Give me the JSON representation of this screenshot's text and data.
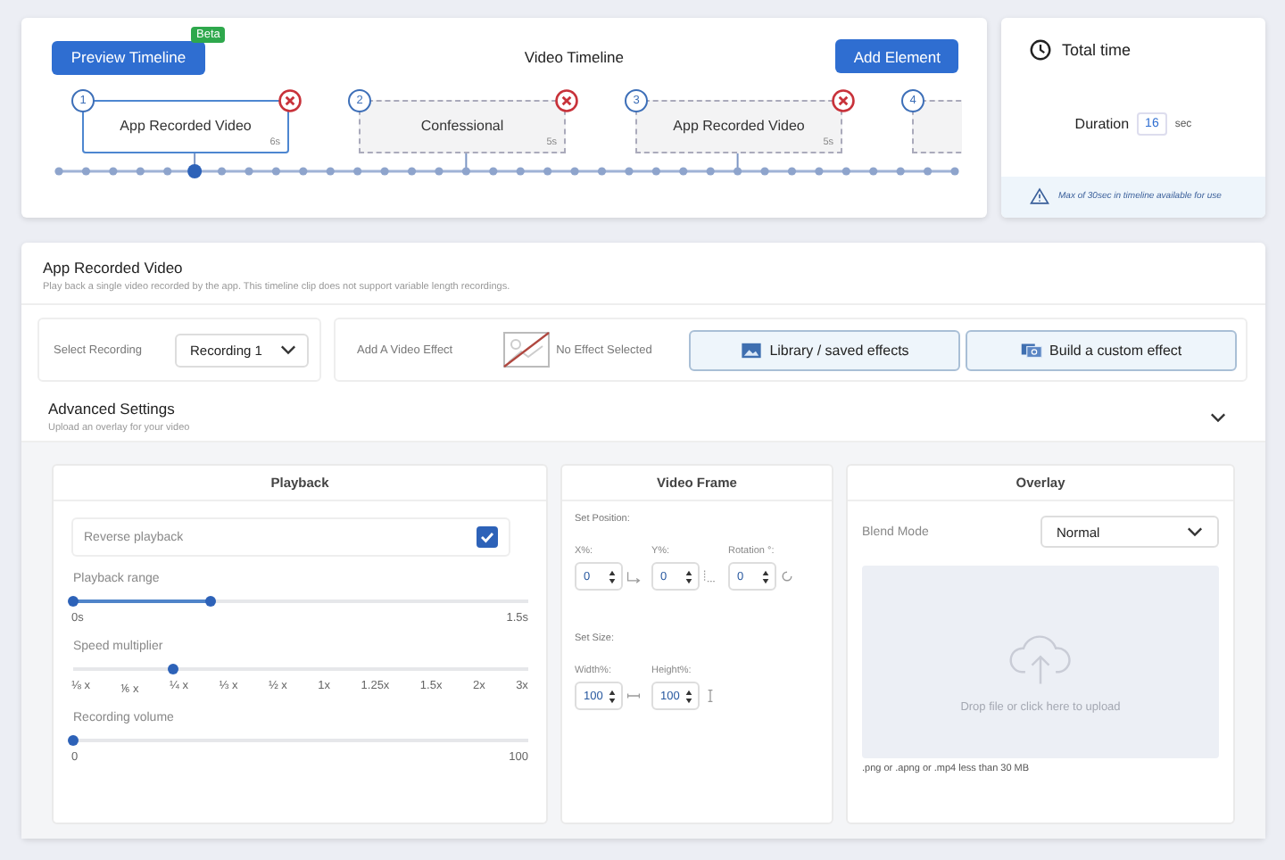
{
  "timeline": {
    "preview_button": "Preview Timeline",
    "badge": "Beta",
    "title": "Video Timeline",
    "add_button": "Add Element",
    "clips": [
      {
        "number": "1",
        "title": "App Recorded Video",
        "duration": "6s",
        "selected": true
      },
      {
        "number": "2",
        "title": "Confessional",
        "duration": "5s",
        "selected": false
      },
      {
        "number": "3",
        "title": "App Recorded Video",
        "duration": "5s",
        "selected": false
      },
      {
        "number": "4",
        "selected": false
      }
    ]
  },
  "total_time": {
    "title": "Total time",
    "duration_label": "Duration",
    "duration_value": "16",
    "unit": "sec",
    "notice": "Max of 30sec in timeline available for use"
  },
  "clip_editor": {
    "title": "App Recorded Video",
    "description": "Play back a single video recorded by the app. This timeline clip does not support variable length recordings.",
    "select_recording": {
      "label": "Select Recording",
      "value": "Recording 1"
    },
    "effect": {
      "label": "Add A Video Effect",
      "status": "No Effect Selected",
      "buttons": [
        "Library / saved effects",
        "Build a custom effect"
      ]
    }
  },
  "advanced": {
    "title": "Advanced Settings",
    "subtitle": "Upload an overlay for your video",
    "playback": {
      "title": "Playback",
      "reverse": {
        "label": "Reverse playback",
        "checked": true
      },
      "range": {
        "label": "Playback range",
        "level": 0.3,
        "min": "0s",
        "max": "1.5s"
      },
      "speed": {
        "label": "Speed multiplier",
        "level": 0.22,
        "ticks": [
          "⅛ x",
          "⅙ x",
          "¼ x",
          "⅓ x",
          "½ x",
          "1x",
          "1.25x",
          "1.5x",
          "2x",
          "3x"
        ]
      },
      "volume": {
        "label": "Recording volume",
        "level": 0,
        "min": "0",
        "max": "100"
      }
    },
    "video_frame": {
      "title": "Video Frame",
      "position_label": "Set Position:",
      "position_fields": [
        {
          "label": "X%:",
          "value": "0"
        },
        {
          "label": "Y%:",
          "value": "0"
        },
        {
          "label": "Rotation °:",
          "value": "0"
        }
      ],
      "size_label": "Set Size:",
      "size_fields": [
        {
          "label": "Width%:",
          "value": "100"
        },
        {
          "label": "Height%:",
          "value": "100"
        }
      ]
    },
    "overlay": {
      "title": "Overlay",
      "blend_label": "Blend Mode",
      "blend_value": "Normal",
      "drop_text": "Drop file or click here to upload",
      "hint": ".png or .apng or .mp4 less than 30 MB"
    }
  }
}
